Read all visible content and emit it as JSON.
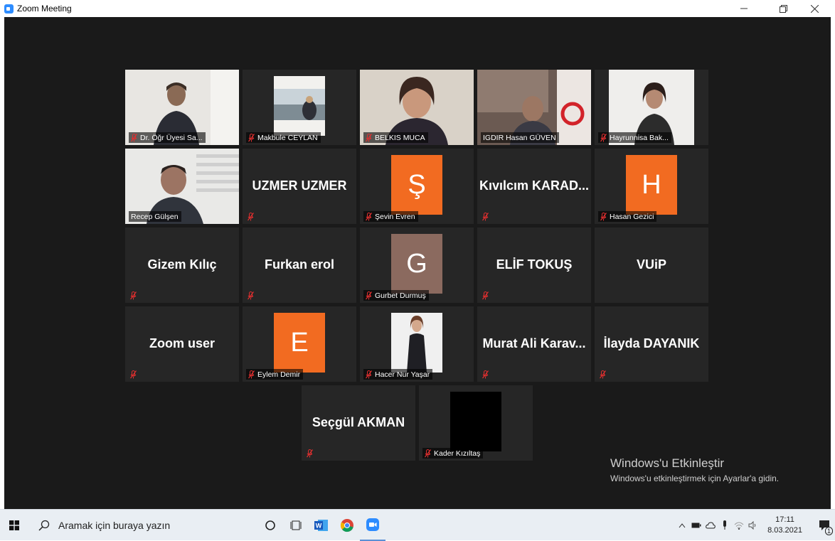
{
  "window": {
    "title": "Zoom Meeting"
  },
  "participants": [
    {
      "name": "Dr. Öğr Üyesi Sa..."
    },
    {
      "name": "Makbule CEYLAN"
    },
    {
      "name": "BELKIS MUCA"
    },
    {
      "name": "IGDIR Hasan GÜVEN"
    },
    {
      "name": "Hayrunnisa Bak..."
    },
    {
      "name": "Recep Gülşen"
    },
    {
      "name": "UZMER UZMER"
    },
    {
      "name": "Şevin Evren",
      "initial": "Ş",
      "color": "#f26b21"
    },
    {
      "name": "Kıvılcım  KARAD..."
    },
    {
      "name": "Hasan Gezici",
      "initial": "H",
      "color": "#f26b21"
    },
    {
      "name": "Gizem Kılıç"
    },
    {
      "name": "Furkan erol"
    },
    {
      "name": "Gurbet Durmuş",
      "initial": "G",
      "color": "#8b6a5f"
    },
    {
      "name": "ELİF TOKUŞ"
    },
    {
      "name": "VUiP"
    },
    {
      "name": "Zoom user"
    },
    {
      "name": "Eylem Demir",
      "initial": "E",
      "color": "#f26b21"
    },
    {
      "name": "Hacer Nur Yaşar"
    },
    {
      "name": "Murat Ali Karav..."
    },
    {
      "name": "İlayda DAYANIK"
    },
    {
      "name": "Seçgül AKMAN"
    },
    {
      "name": "Kader Kızıltaş"
    }
  ],
  "watermark": {
    "title": "Windows'u Etkinleştir",
    "subtitle": "Windows'u etkinleştirmek için Ayarlar'a gidin."
  },
  "taskbar": {
    "search_placeholder": "Aramak için buraya yazın",
    "time": "17:11",
    "date": "8.03.2021",
    "notification_count": "1"
  },
  "colors": {
    "accent": "#2d8cff",
    "speaking_border": "#d7e25c",
    "muted_icon": "#e02f2f"
  }
}
